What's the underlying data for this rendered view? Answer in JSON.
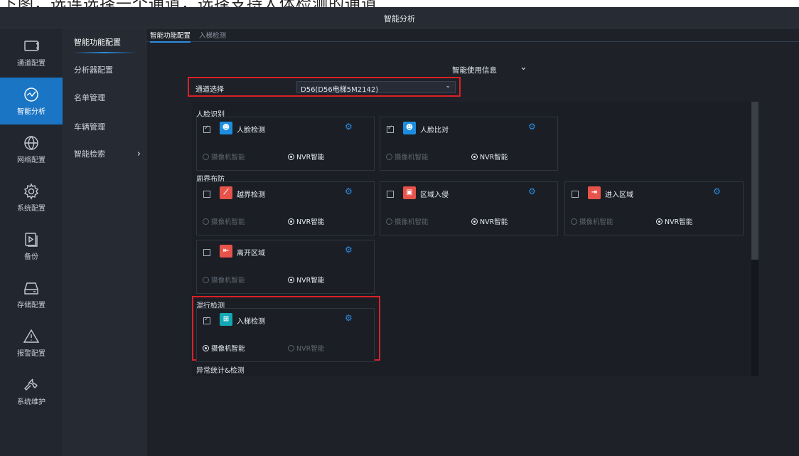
{
  "top_caption": "下图，选连选择一个通道，选择支持人体检测的通道",
  "window": {
    "title": "智能分析"
  },
  "nav": [
    {
      "label": "通道配置",
      "icon": "monitor-icon",
      "active": false
    },
    {
      "label": "智能分析",
      "icon": "analytics-icon",
      "active": true
    },
    {
      "label": "网络配置",
      "icon": "globe-icon",
      "active": false
    },
    {
      "label": "系统配置",
      "icon": "gear-icon",
      "active": false
    },
    {
      "label": "备份",
      "icon": "backup-icon",
      "active": false
    },
    {
      "label": "存储配置",
      "icon": "storage-icon",
      "active": false
    },
    {
      "label": "报警配置",
      "icon": "alert-icon",
      "active": false
    },
    {
      "label": "系统维护",
      "icon": "wrench-icon",
      "active": false
    }
  ],
  "subnav": [
    {
      "label": "智能功能配置",
      "active": true
    },
    {
      "label": "分析器配置",
      "active": false
    },
    {
      "label": "名单管理",
      "active": false
    },
    {
      "label": "车辆管理",
      "active": false
    },
    {
      "label": "智能检索",
      "active": false,
      "has_chevron": true
    }
  ],
  "tabs": [
    {
      "label": "智能功能配置",
      "active": true
    },
    {
      "label": "入梯检测",
      "active": false
    }
  ],
  "info": {
    "label": "智能使用信息"
  },
  "channel": {
    "label": "通道选择",
    "value": "D56(D56电梯5M2142)"
  },
  "sections": {
    "face": "人脸识别",
    "perimeter": "周界布防",
    "mixed": "混行检测",
    "abnormal": "异常统计&检测"
  },
  "options": {
    "camera": "摄像机智能",
    "nvr": "NVR智能"
  },
  "cards": [
    {
      "name": "人脸检测",
      "checked": true,
      "icon": "face-detect-icon",
      "color": "#1c8de0",
      "mode": "nvr"
    },
    {
      "name": "人脸比对",
      "checked": true,
      "icon": "face-compare-icon",
      "color": "#1c8de0",
      "mode": "nvr"
    },
    {
      "name": "越界检测",
      "checked": false,
      "icon": "line-cross-icon",
      "color": "#e7534a",
      "mode": "nvr"
    },
    {
      "name": "区域入侵",
      "checked": false,
      "icon": "intrusion-icon",
      "color": "#e7534a",
      "mode": "nvr"
    },
    {
      "name": "进入区域",
      "checked": false,
      "icon": "enter-area-icon",
      "color": "#e7534a",
      "mode": "nvr"
    },
    {
      "name": "离开区域",
      "checked": false,
      "icon": "leave-area-icon",
      "color": "#e7534a",
      "mode": "nvr"
    },
    {
      "name": "入梯检测",
      "checked": true,
      "icon": "elevator-icon",
      "color": "#13a7b5",
      "mode": "camera"
    }
  ]
}
